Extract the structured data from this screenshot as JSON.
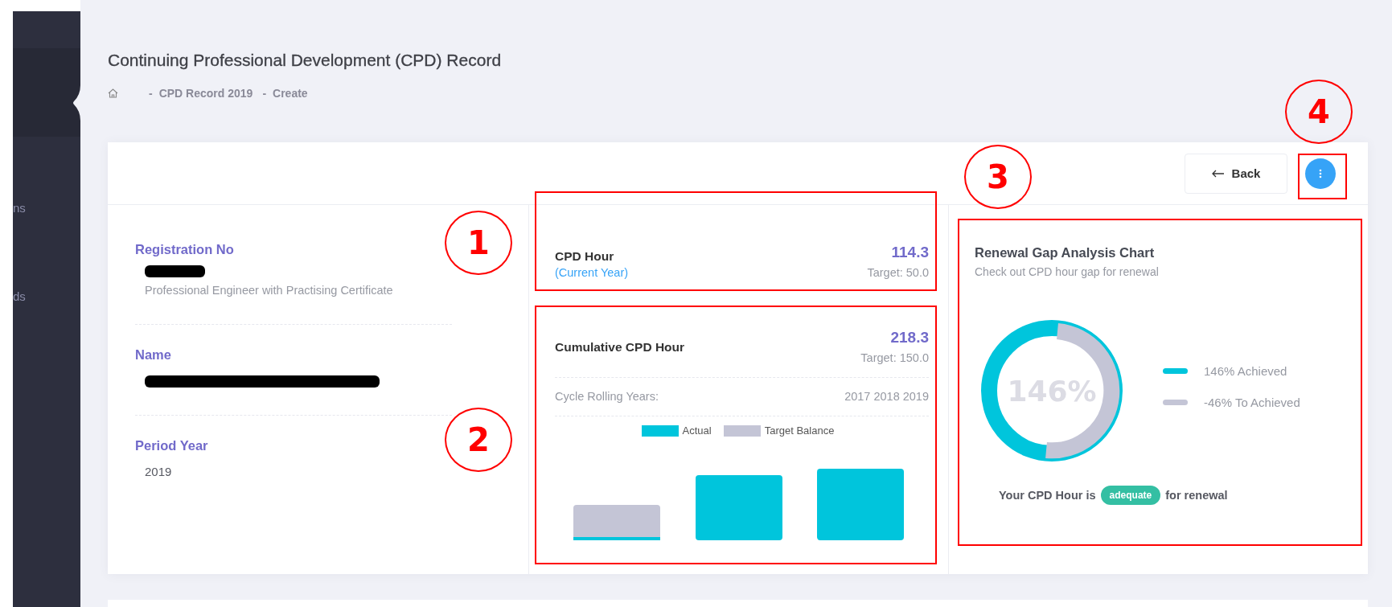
{
  "sidebar": {
    "items": [
      {
        "label": "ns"
      },
      {
        "label": "ds"
      }
    ]
  },
  "page": {
    "title": "Continuing Professional Development (CPD) Record",
    "breadcrumb": [
      {
        "sep": "-",
        "label": "CPD Record 2019"
      },
      {
        "sep": "-",
        "label": "Create"
      }
    ]
  },
  "toolbar": {
    "back_button": "Back"
  },
  "details": [
    {
      "label": "Registration No",
      "value_redacted": true,
      "note": "Professional Engineer with Practising Certificate"
    },
    {
      "label": "Name",
      "value_redacted": true
    },
    {
      "label": "Period Year",
      "value": "2019"
    }
  ],
  "cpd_hour": {
    "title": "CPD Hour",
    "subtitle": "(Current Year)",
    "value": "114.3",
    "target": "Target: 50.0"
  },
  "cumulative": {
    "title": "Cumulative CPD Hour",
    "value": "218.3",
    "target": "Target: 150.0",
    "cycle_label": "Cycle Rolling Years:",
    "cycle_years": "2017 2018 2019",
    "legend": [
      {
        "label": "Actual",
        "color": "#00c5dc"
      },
      {
        "label": "Target Balance",
        "color": "#c4c5d6"
      }
    ]
  },
  "renewal": {
    "title": "Renewal Gap Analysis Chart",
    "subtitle": "Check out CPD hour gap for renewal",
    "center_label": "146%",
    "legend": [
      {
        "label": "146% Achieved",
        "color": "#00c5dc"
      },
      {
        "label": "-46% To Achieved",
        "color": "#c4c5d6"
      }
    ],
    "status_prefix": "Your CPD Hour is",
    "status_badge": "adequate",
    "status_suffix": "for renewal"
  },
  "annotations": {
    "callouts": [
      "1",
      "2",
      "3",
      "4"
    ]
  }
}
